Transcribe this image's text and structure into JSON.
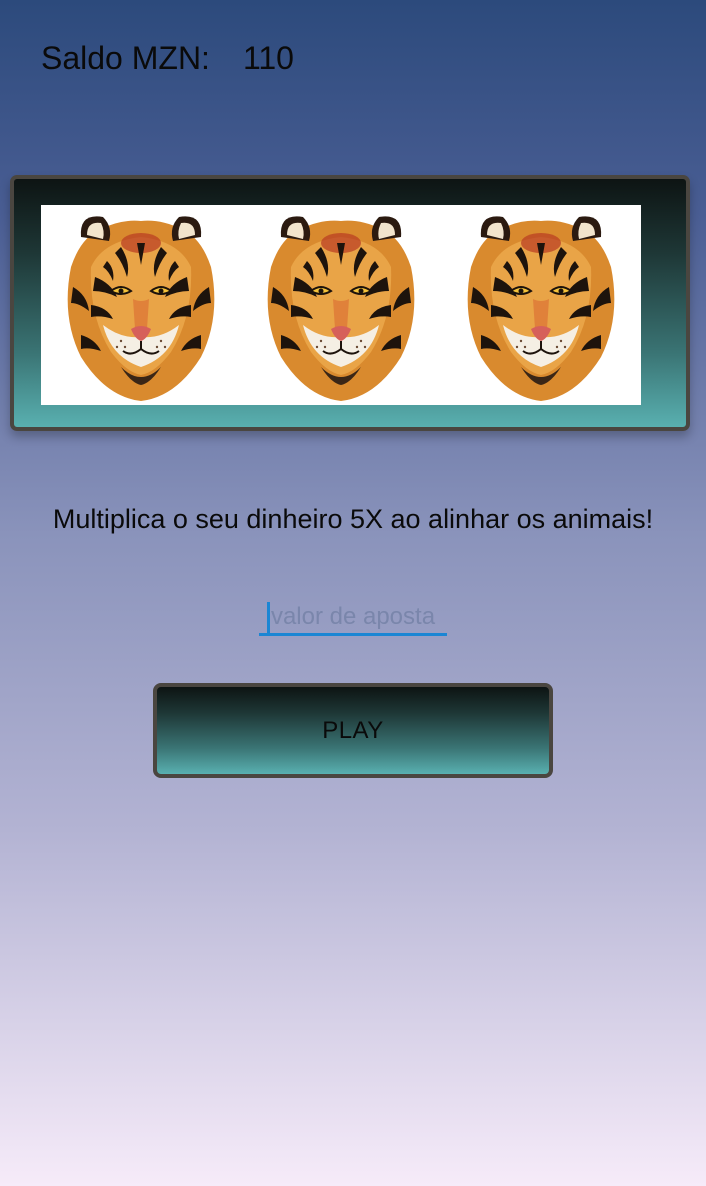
{
  "header": {
    "balance_label": "Saldo MZN:",
    "balance_value": "110"
  },
  "slot": {
    "reels": [
      {
        "icon": "tiger-face-icon"
      },
      {
        "icon": "tiger-face-icon"
      },
      {
        "icon": "tiger-face-icon"
      }
    ]
  },
  "main": {
    "tagline": "Multiplica o seu dinheiro 5X ao alinhar os animais!",
    "bet_placeholder": "valor de aposta",
    "play_label": "PLAY"
  },
  "colors": {
    "accent": "#1b86d4",
    "frame_border": "#4a4640",
    "frame_bottom": "#59b0b0"
  }
}
